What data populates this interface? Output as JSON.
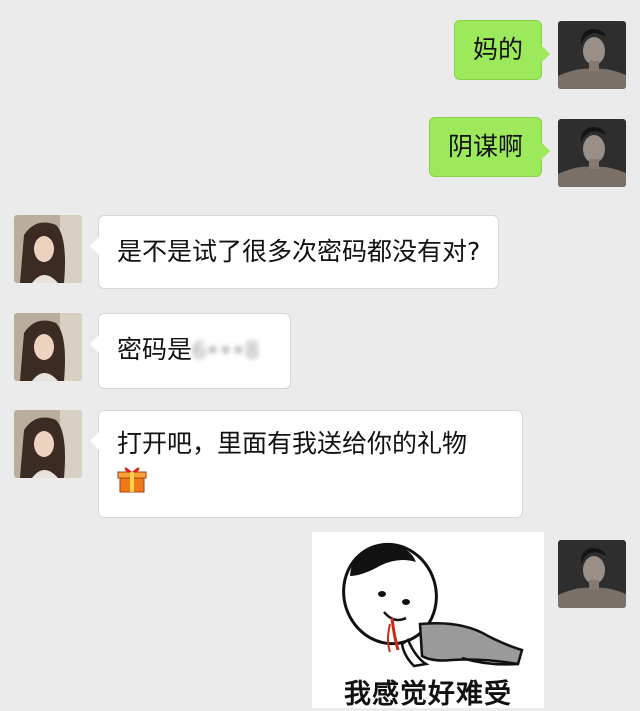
{
  "messages": [
    {
      "sender": "self",
      "text": "妈的"
    },
    {
      "sender": "self",
      "text": "阴谋啊"
    },
    {
      "sender": "other",
      "text": "是不是试了很多次密码都没有对?"
    },
    {
      "sender": "other",
      "text": "密码是",
      "masked_text": "6•••8"
    },
    {
      "sender": "other",
      "text": "打开吧，里面有我送给你的礼物",
      "emoji": "gift-icon"
    },
    {
      "sender": "self",
      "type": "sticker",
      "caption": "我感觉好难受"
    }
  ],
  "colors": {
    "background": "#ebebeb",
    "self_bubble": "#9de95c",
    "other_bubble": "#ffffff"
  }
}
